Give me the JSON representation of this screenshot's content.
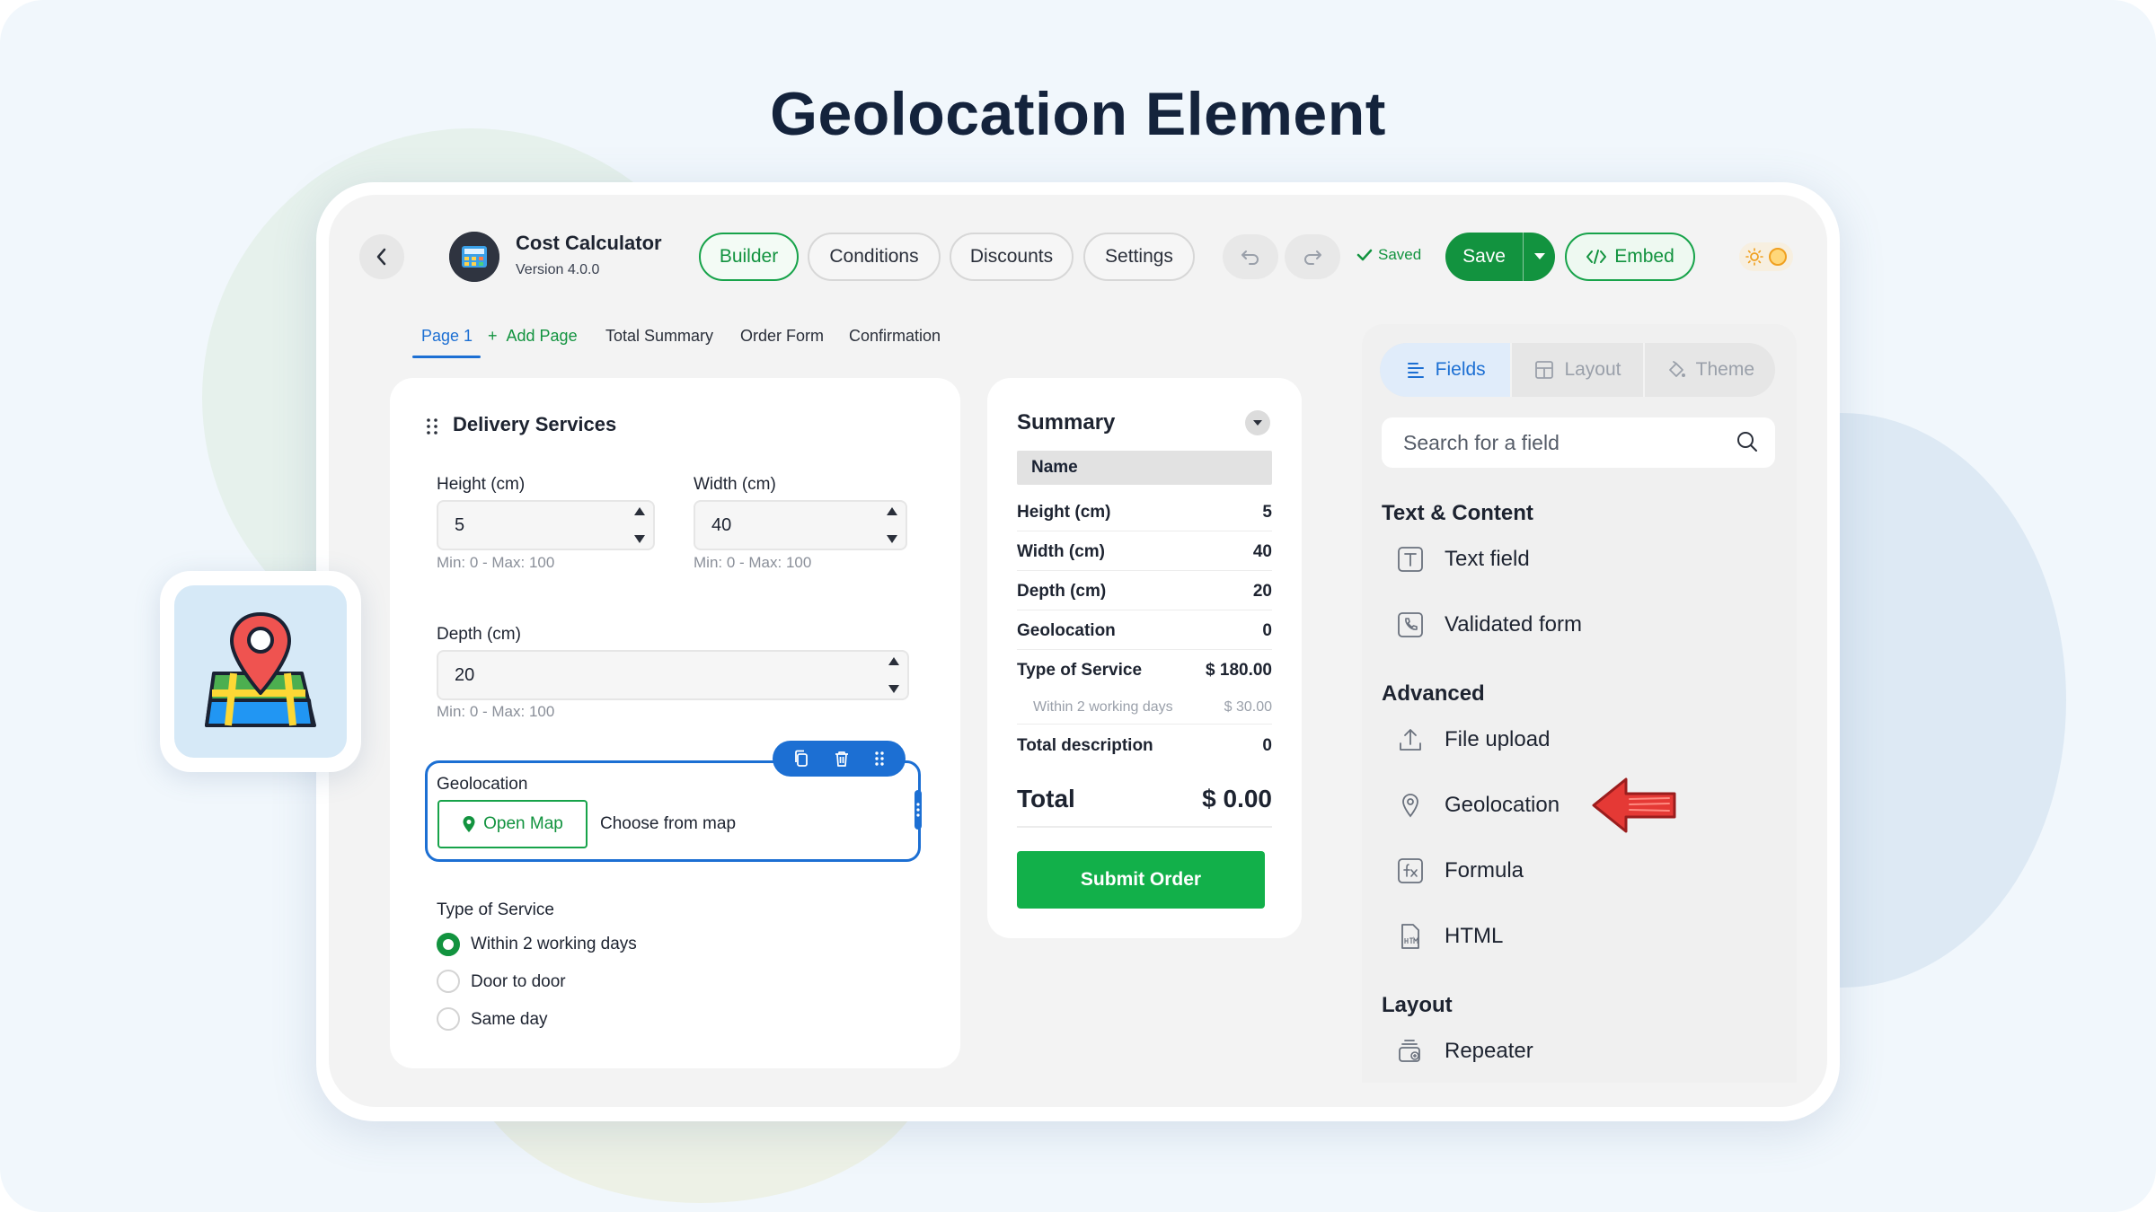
{
  "headline": "Geolocation Element",
  "app": {
    "title": "Cost Calculator",
    "version": "Version 4.0.0"
  },
  "nav": {
    "builder": "Builder",
    "conditions": "Conditions",
    "discounts": "Discounts",
    "settings": "Settings"
  },
  "status": {
    "saved": "Saved"
  },
  "actions": {
    "save": "Save",
    "embed": "Embed"
  },
  "page_tabs": {
    "page1": "Page 1",
    "add_page": "Add Page",
    "total_summary": "Total Summary",
    "order_form": "Order Form",
    "confirmation": "Confirmation"
  },
  "form": {
    "section_title": "Delivery Services",
    "height": {
      "label": "Height (cm)",
      "value": "5",
      "hint": "Min: 0 - Max: 100"
    },
    "width": {
      "label": "Width (cm)",
      "value": "40",
      "hint": "Min: 0 - Max: 100"
    },
    "depth": {
      "label": "Depth (cm)",
      "value": "20",
      "hint": "Min: 0 - Max: 100"
    },
    "geolocation": {
      "label": "Geolocation",
      "open_map": "Open Map",
      "choose": "Choose from map"
    },
    "service": {
      "label": "Type of Service",
      "options": [
        "Within 2 working days",
        "Door to door",
        "Same day"
      ],
      "selected": "Within 2 working days"
    }
  },
  "summary": {
    "title": "Summary",
    "name_header": "Name",
    "rows": [
      {
        "label": "Height (cm)",
        "value": "5"
      },
      {
        "label": "Width (cm)",
        "value": "40"
      },
      {
        "label": "Depth (cm)",
        "value": "20"
      },
      {
        "label": "Geolocation",
        "value": "0"
      },
      {
        "label": "Type of Service",
        "value": "$ 180.00"
      },
      {
        "label": "Within 2 working days",
        "value": "$ 30.00"
      },
      {
        "label": "Total description",
        "value": "0"
      }
    ],
    "total_label": "Total",
    "total_value": "$ 0.00",
    "submit": "Submit Order"
  },
  "panel": {
    "tabs": {
      "fields": "Fields",
      "layout": "Layout",
      "theme": "Theme"
    },
    "search_placeholder": "Search for a field",
    "groups": {
      "text_content": {
        "title": "Text & Content",
        "items": [
          "Text field",
          "Validated form"
        ]
      },
      "advanced": {
        "title": "Advanced",
        "items": [
          "File upload",
          "Geolocation",
          "Formula",
          "HTML"
        ]
      },
      "layout": {
        "title": "Layout",
        "items": [
          "Repeater"
        ]
      }
    }
  },
  "colors": {
    "accent_green": "#12933f",
    "accent_blue": "#1c6fd3",
    "arrow_red": "#e53935",
    "headline": "#14233c"
  }
}
